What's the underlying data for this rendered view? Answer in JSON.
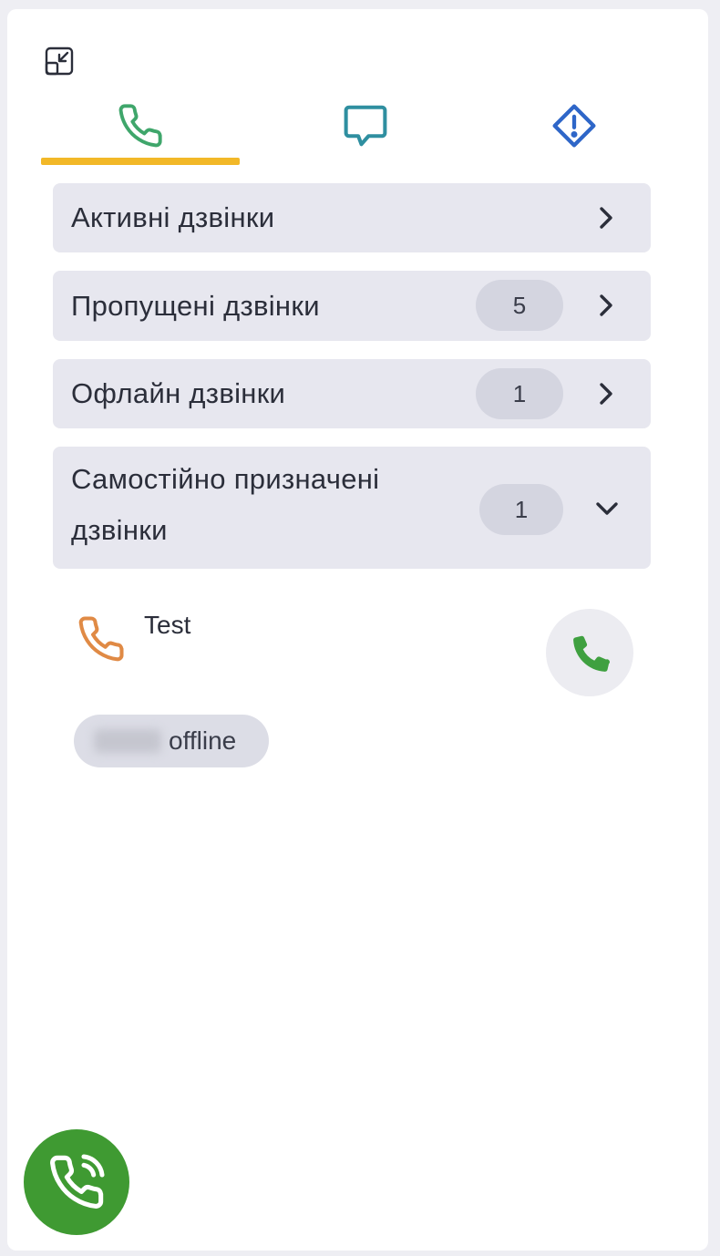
{
  "tabs": [
    {
      "icon": "phone-icon",
      "color": "#3fa66b",
      "active": true
    },
    {
      "icon": "chat-icon",
      "color": "#2f8fa0",
      "active": false
    },
    {
      "icon": "alert-diamond-icon",
      "color": "#2e66c8",
      "active": false
    }
  ],
  "colors": {
    "tab_indicator": "#f2b828",
    "section_bg": "#e7e7ef",
    "badge_bg": "#d4d5e0",
    "incoming_call_icon": "#e08a45",
    "answer_icon": "#3fa040",
    "fab_bg": "#3f9a32"
  },
  "sections": [
    {
      "label": "Активні дзвінки",
      "badge": null,
      "expanded": false
    },
    {
      "label": "Пропущені дзвінки",
      "badge": "5",
      "expanded": false
    },
    {
      "label": "Офлайн дзвінки",
      "badge": "1",
      "expanded": false
    },
    {
      "label_line1": "Самостійно призначені",
      "label_line2": "дзвінки",
      "badge": "1",
      "expanded": true
    }
  ],
  "call_item": {
    "name": "Test",
    "status": "offline",
    "icon": "phone-incoming-icon",
    "action_icon": "phone-answer-icon"
  },
  "fab": {
    "icon": "phone-ringing-icon"
  }
}
